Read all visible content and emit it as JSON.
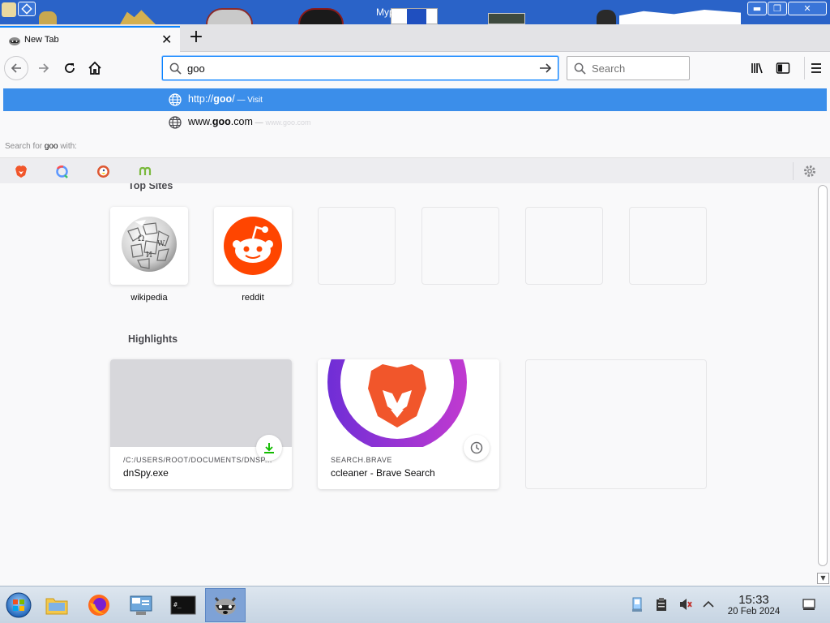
{
  "window": {
    "title": "Mypa"
  },
  "tab": {
    "label": "New Tab"
  },
  "urlbar": {
    "value": "goo"
  },
  "searchbar": {
    "placeholder": "Search"
  },
  "autocomplete": {
    "rows": [
      {
        "prefix": "http://",
        "match": "goo",
        "suffix": "/",
        "sep": " — ",
        "action": "Visit",
        "selected": true
      },
      {
        "prefix": "www.",
        "match": "goo",
        "suffix": ".com",
        "sep": " — ",
        "url": "www.goo.com",
        "selected": false
      }
    ],
    "search_for_prefix": "Search for ",
    "search_for_term": "goo",
    "search_for_suffix": " with:",
    "engines": [
      "brave-icon",
      "qwant-icon",
      "duckduckgo-icon",
      "mojeek-icon"
    ]
  },
  "top_sites": {
    "title": "Top Sites",
    "tiles": [
      {
        "label": "wikipedia",
        "icon": "wikipedia-globe-icon"
      },
      {
        "label": "reddit",
        "icon": "reddit-icon"
      },
      {
        "label": ""
      },
      {
        "label": ""
      },
      {
        "label": ""
      },
      {
        "label": ""
      }
    ]
  },
  "highlights": {
    "title": "Highlights",
    "cards": [
      {
        "host": "/C:/USERS/ROOT/DOCUMENTS/DNSP...",
        "title": "dnSpy.exe",
        "badge": "download-icon"
      },
      {
        "host": "SEARCH.BRAVE",
        "title": "ccleaner - Brave Search",
        "badge": "history-clock-icon"
      }
    ]
  },
  "taskbar": {
    "apps": [
      "start-orb-icon",
      "file-explorer-icon",
      "firefox-icon",
      "control-panel-icon",
      "terminal-icon",
      "raccoon-app-icon"
    ],
    "clock": {
      "time": "15:33",
      "date": "20 Feb 2024"
    }
  },
  "colors": {
    "accent": "#0a84ff",
    "selected_row": "#3b8eea",
    "titlebar": "#2a63c8"
  }
}
